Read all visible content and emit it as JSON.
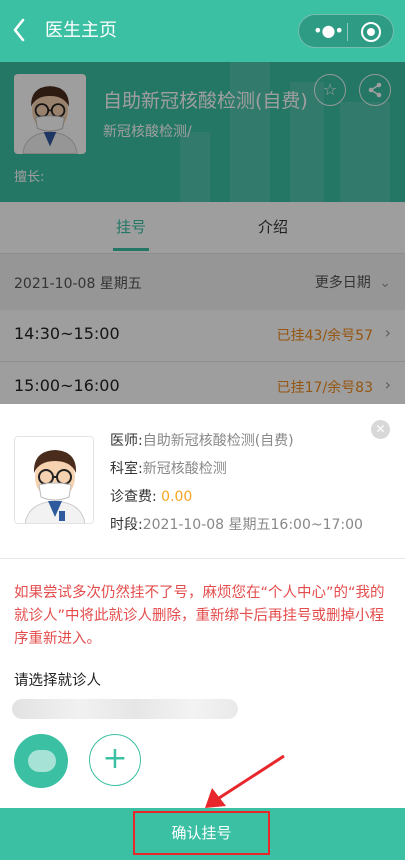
{
  "header": {
    "back_icon": "chevron-left-icon",
    "title": "医生主页",
    "menu_icon": "more-dots-icon",
    "close_icon": "target-circle-icon"
  },
  "doctor": {
    "name": "自助新冠核酸检测(自费)",
    "department": "新冠核酸检测/",
    "specialty_label": "擅长:",
    "favorite_icon": "star-icon",
    "share_icon": "share-icon"
  },
  "tabs": [
    {
      "label": "挂号",
      "active": true
    },
    {
      "label": "介绍",
      "active": false
    }
  ],
  "schedule": {
    "date": "2021-10-08 星期五",
    "more_dates": "更多日期",
    "slots": [
      {
        "time": "14:30~15:00",
        "status": "已挂43/余号57"
      },
      {
        "time": "15:00~16:00",
        "status": "已挂17/余号83"
      }
    ]
  },
  "sheet": {
    "doctor_label": "医师:",
    "doctor_value": "自助新冠核酸检测(自费)",
    "dept_label": "科室:",
    "dept_value": "新冠核酸检测",
    "fee_label": "诊查费:",
    "fee_value": "0.00",
    "period_label": "时段:",
    "period_value": "2021-10-08 星期五16:00~17:00",
    "warning": "如果尝试多次仍然挂不了号，麻烦您在“个人中心”的“我的就诊人”中将此就诊人删除，重新绑卡后再挂号或删掉小程序重新进入。",
    "choose_patient": "请选择就诊人",
    "add_icon": "plus-icon",
    "confirm": "确认挂号"
  },
  "colors": {
    "brand": "#3bc0a4",
    "warning": "#e44c4c",
    "slot_status": "#f08c1c",
    "fee": "#f5a623",
    "annotation": "#e8272c"
  }
}
